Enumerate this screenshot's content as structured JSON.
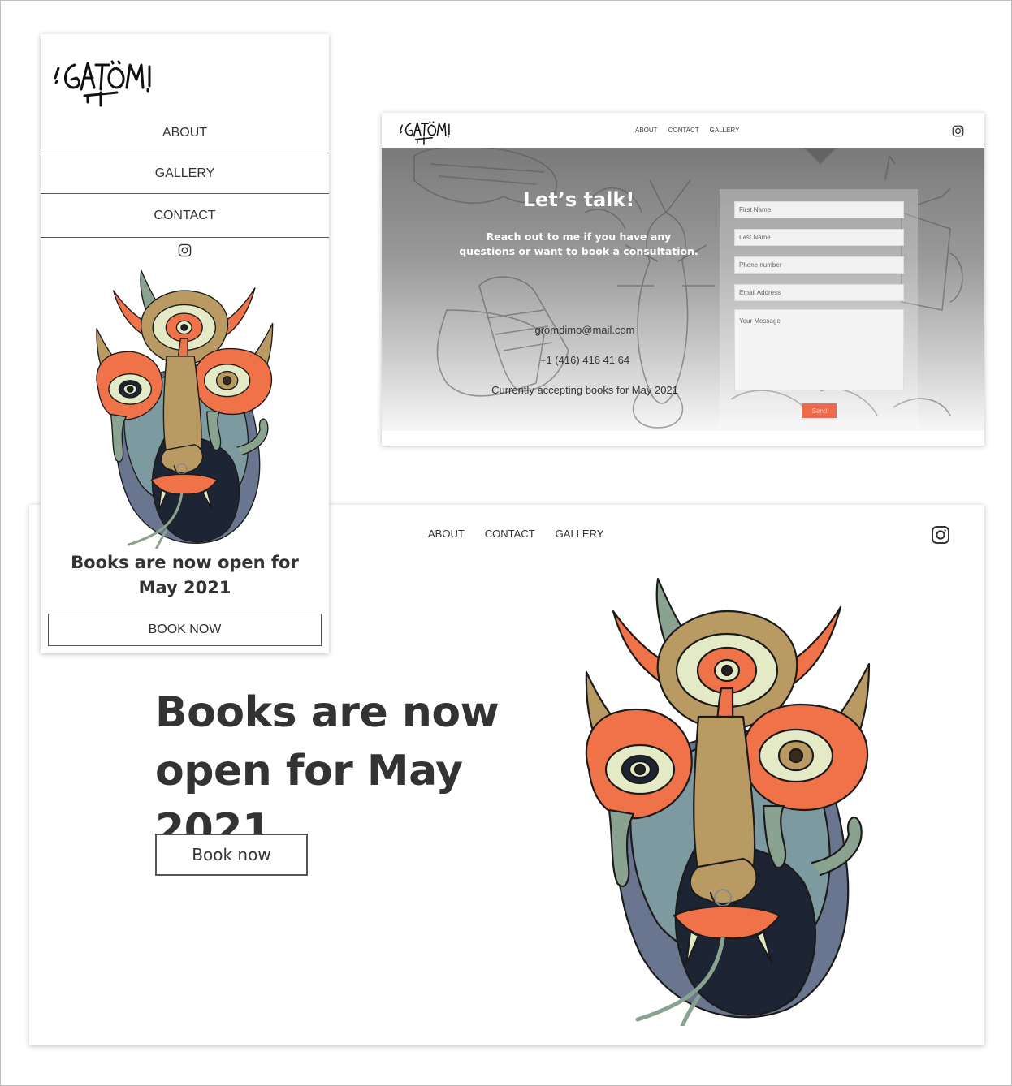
{
  "desktop": {
    "nav": {
      "about": "ABOUT",
      "contact": "CONTACT",
      "gallery": "GALLERY"
    },
    "icons": {
      "social": "instagram-icon"
    },
    "headline": "Books are now open for May 2021",
    "book_button": "Book now"
  },
  "mobile": {
    "menu": [
      "ABOUT",
      "GALLERY",
      "CONTACT"
    ],
    "icons": {
      "social": "instagram-icon"
    },
    "headline": "Books are now open for May 2021",
    "book_button": "BOOK NOW"
  },
  "contact": {
    "nav": {
      "about": "ABOUT",
      "contact": "CONTACT",
      "gallery": "GALLERY"
    },
    "title": "Let’s talk!",
    "subtitle": "Reach out to me if you have any questions or want to book a consultation.",
    "email": "gromdimo@mail.com",
    "phone": "+1 (416) 416 41 64",
    "status": "Currently accepting books for May 2021",
    "form": {
      "first_name": "First Name",
      "last_name": "Last Name",
      "phone": "Phone number",
      "email": "Email Address",
      "message": "Your Message",
      "send": "Send"
    }
  },
  "colors": {
    "accent": "#ee6a4d",
    "mask_orange": "#ef7249",
    "mask_teal": "#7d9aa0",
    "mask_navy": "#1d2433",
    "mask_gold": "#b89a62",
    "mask_cream": "#e4e9c6",
    "mask_sage": "#8aa391",
    "mask_slate": "#6a7590",
    "text": "#333333"
  }
}
